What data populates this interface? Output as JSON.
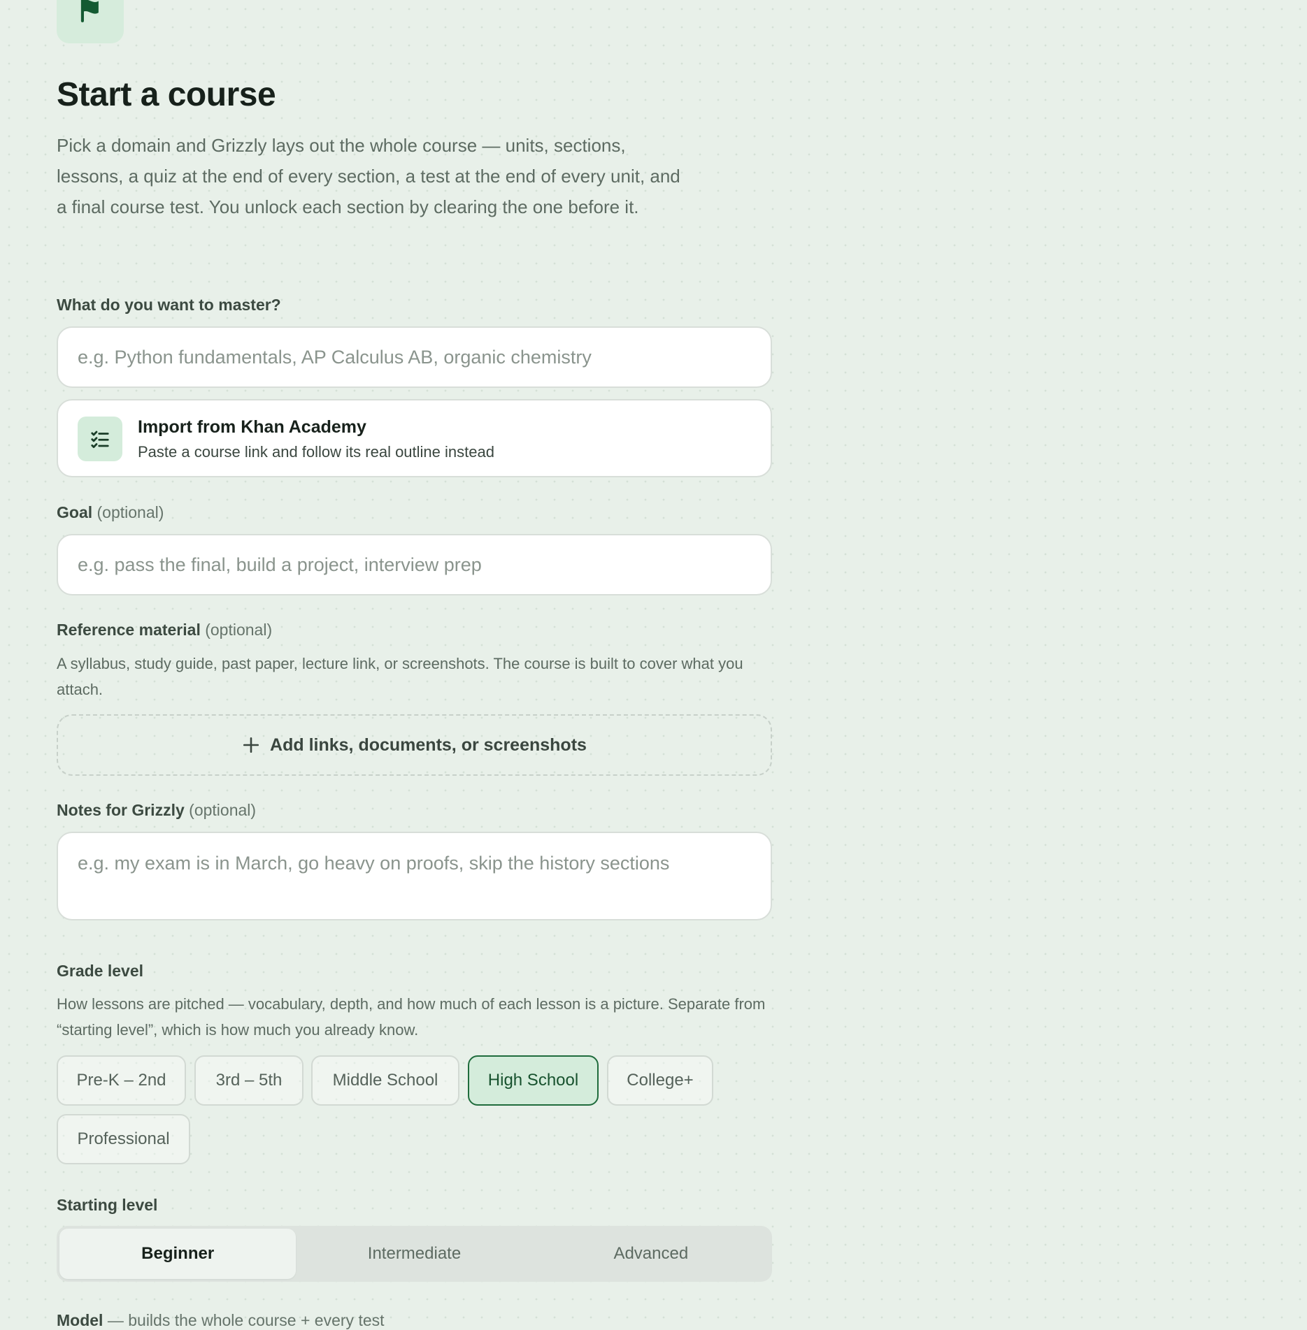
{
  "header": {
    "logo_icon": "flag-icon",
    "title": "Start a course",
    "intro": "Pick a domain and Grizzly lays out the whole course — units, sections, lessons, a quiz at the end of every section, a test at the end of every unit, and a final course test. You unlock each section by clearing the one before it."
  },
  "topic": {
    "label": "What do you want to master?",
    "placeholder": "e.g. Python fundamentals, AP Calculus AB, organic chemistry",
    "value": ""
  },
  "import": {
    "icon": "checklist-icon",
    "title": "Import from Khan Academy",
    "subtitle": "Paste a course link and follow its real outline instead"
  },
  "goal": {
    "label": "Goal",
    "optional": "(optional)",
    "placeholder": "e.g. pass the final, build a project, interview prep",
    "value": ""
  },
  "reference": {
    "label": "Reference material",
    "optional": "(optional)",
    "help": "A syllabus, study guide, past paper, lecture link, or screenshots. The course is built to cover what you attach.",
    "button_icon": "plus-icon",
    "button_label": "Add links, documents, or screenshots"
  },
  "notes": {
    "label": "Notes for Grizzly",
    "optional": "(optional)",
    "placeholder": "e.g. my exam is in March, go heavy on proofs, skip the history sections",
    "value": ""
  },
  "grade": {
    "label": "Grade level",
    "help": "How lessons are pitched — vocabulary, depth, and how much of each lesson is a picture. Separate from “starting level”, which is how much you already know.",
    "options": [
      "Pre-K – 2nd",
      "3rd – 5th",
      "Middle School",
      "High School",
      "College+",
      "Professional"
    ],
    "selected": "High School"
  },
  "starting_level": {
    "label": "Starting level",
    "options": [
      "Beginner",
      "Intermediate",
      "Advanced"
    ],
    "selected": "Beginner"
  },
  "model": {
    "label": "Model",
    "description": "— builds the whole course + every test"
  },
  "colors": {
    "background": "#e8f0e9",
    "accent": "#1f6b3c",
    "accent_light": "#d4ecdb",
    "text": "#1d2520",
    "muted": "#5d6b62"
  }
}
